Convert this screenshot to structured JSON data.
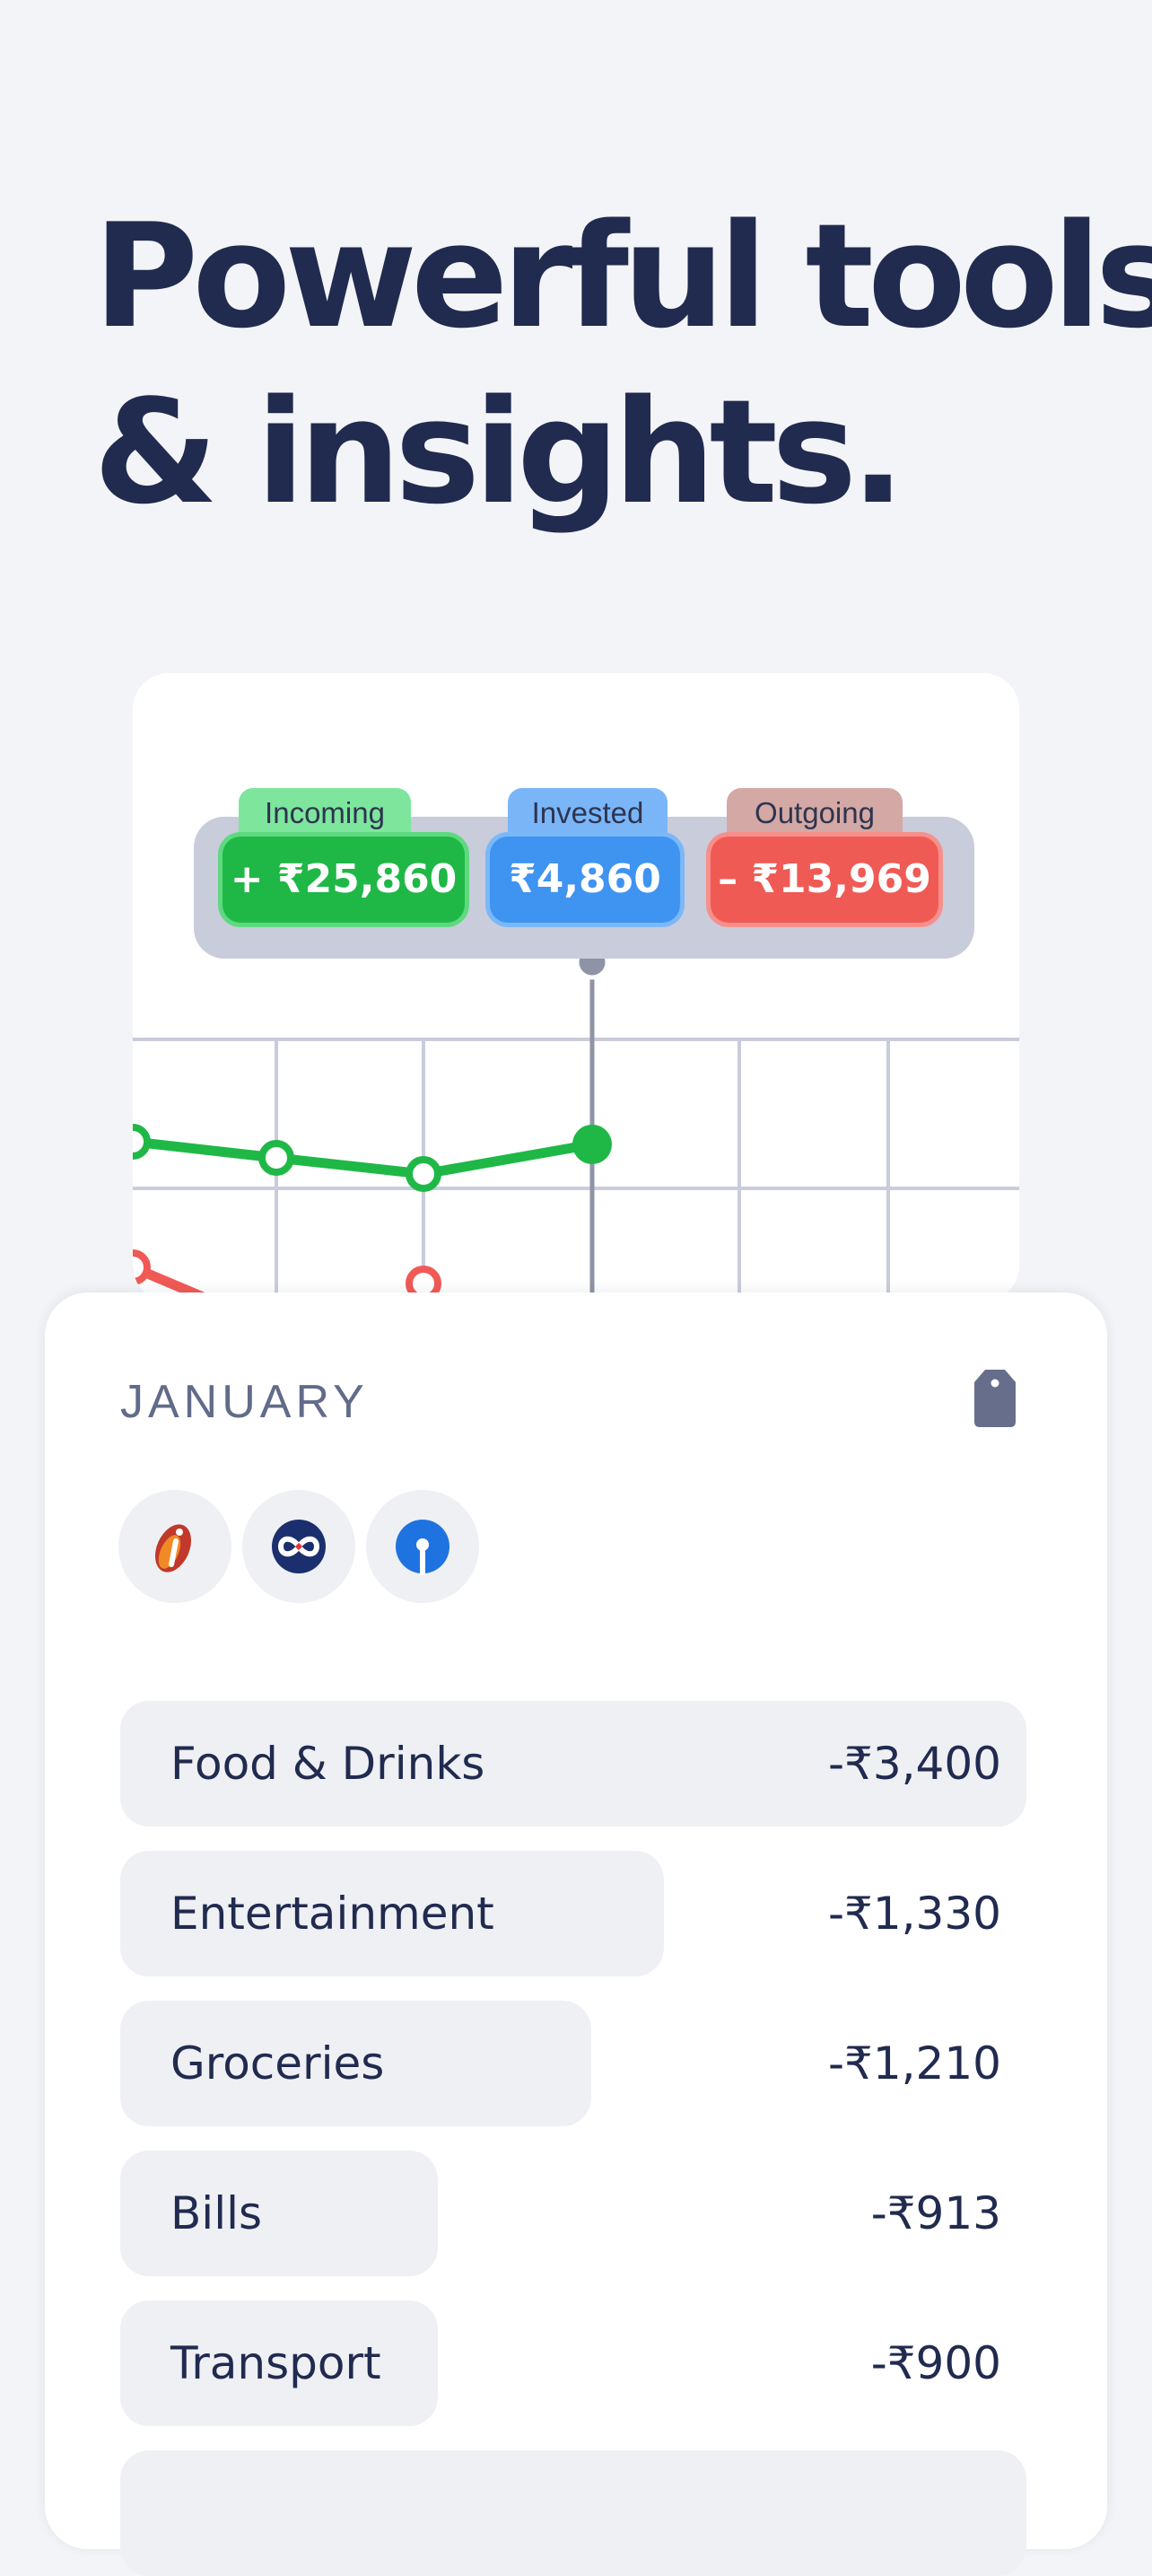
{
  "headline": {
    "line1": "Powerful tools",
    "line2": "& insights."
  },
  "summary": {
    "incoming": {
      "label": "Incoming",
      "value": "+ ₹25,860",
      "color": "#1fb847"
    },
    "invested": {
      "label": "Invested",
      "value": "₹4,860",
      "color": "#3f93f1"
    },
    "outgoing": {
      "label": "Outgoing",
      "value": "– ₹13,969",
      "color": "#f05a55"
    }
  },
  "chart": {
    "incoming_color": "#1fb847",
    "outgoing_color": "#f05a55"
  },
  "sheet": {
    "month": "JANUARY",
    "tag_icon": "price-tag-icon",
    "banks": [
      {
        "name": "icici-logo-icon",
        "color": "#c0392b"
      },
      {
        "name": "kotak-logo-icon",
        "color": "#1b2f6e"
      },
      {
        "name": "sbi-logo-icon",
        "color": "#1f73e0"
      }
    ],
    "categories": [
      {
        "label": "Food & Drinks",
        "amount": "-₹3,400",
        "share": 1.0
      },
      {
        "label": "Entertainment",
        "amount": "-₹1,330",
        "share": 0.6
      },
      {
        "label": "Groceries",
        "amount": "-₹1,210",
        "share": 0.52
      },
      {
        "label": "Bills",
        "amount": "-₹913",
        "share": 0.35
      },
      {
        "label": "Transport",
        "amount": "-₹900",
        "share": 0.35
      }
    ]
  }
}
